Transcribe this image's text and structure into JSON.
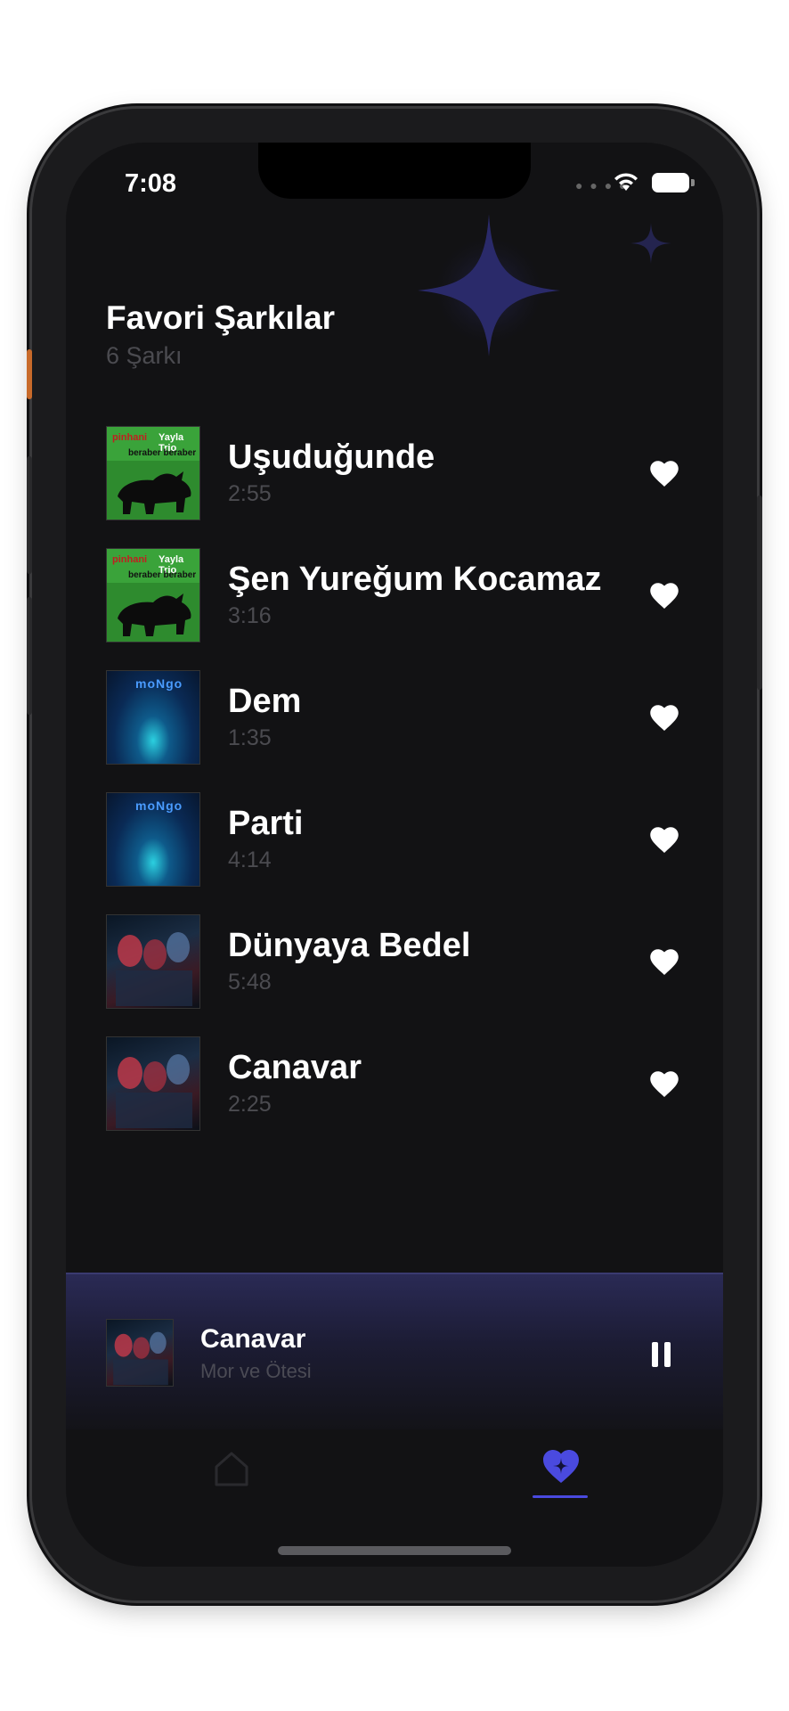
{
  "status_bar": {
    "time": "7:08"
  },
  "header": {
    "title": "Favori Şarkılar",
    "subtitle": "6 Şarkı"
  },
  "songs": [
    {
      "title": "Uşuduğunde",
      "duration": "2:55",
      "cover": "green"
    },
    {
      "title": "Şen Yureğum Kocamaz",
      "duration": "3:16",
      "cover": "green"
    },
    {
      "title": "Dem",
      "duration": "1:35",
      "cover": "blue"
    },
    {
      "title": "Parti",
      "duration": "4:14",
      "cover": "blue"
    },
    {
      "title": "Dünyaya Bedel",
      "duration": "5:48",
      "cover": "red"
    },
    {
      "title": "Canavar",
      "duration": "2:25",
      "cover": "red"
    }
  ],
  "covers": {
    "green": {
      "text_left": "pinhani",
      "text_right": "Yayla Trio",
      "text_bottom": "beraber beraber"
    },
    "blue": {
      "logo": "moNgo"
    }
  },
  "now_playing": {
    "title": "Canavar",
    "artist": "Mor ve Ötesi",
    "state": "playing"
  },
  "tabs": [
    {
      "name": "home",
      "icon": "home-icon",
      "active": false
    },
    {
      "name": "favorites",
      "icon": "heart-sparkle-icon",
      "active": true
    }
  ],
  "colors": {
    "background": "#121214",
    "accent": "#4a4adf",
    "secondary_text": "#4b4b50",
    "mini_player_top": "#2a2a55"
  }
}
